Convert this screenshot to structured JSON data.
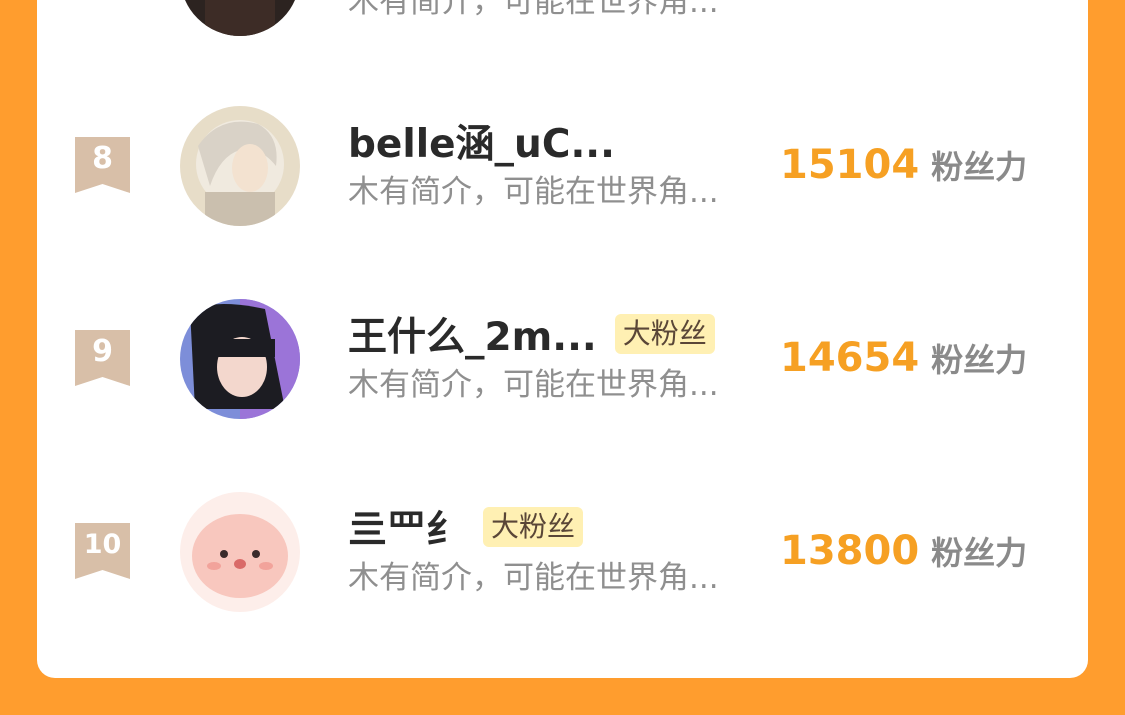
{
  "rows": [
    {
      "rank": "",
      "name": "",
      "intro": "木有简介，可能在世界角...",
      "badge": "",
      "score": "",
      "score_unit": ""
    },
    {
      "rank": "8",
      "name": "belle涵_uC...",
      "intro": "木有简介，可能在世界角...",
      "badge": "",
      "score": "15104",
      "score_unit": "粉丝力"
    },
    {
      "rank": "9",
      "name": "王什么_2m...",
      "intro": "木有简介，可能在世界角...",
      "badge": "大粉丝",
      "score": "14654",
      "score_unit": "粉丝力"
    },
    {
      "rank": "10",
      "name": "亖罒纟",
      "intro": "木有简介，可能在世界角...",
      "badge": "大粉丝",
      "score": "13800",
      "score_unit": "粉丝力"
    }
  ],
  "colors": {
    "background": "#ff9d2e",
    "card": "#ffffff",
    "score": "#f6a023",
    "rank_ribbon": "#d8bfa8",
    "badge_bg": "#fff0b3"
  },
  "icons": {
    "rank": "bookmark-ribbon-icon",
    "avatar": "user-avatar-image"
  }
}
